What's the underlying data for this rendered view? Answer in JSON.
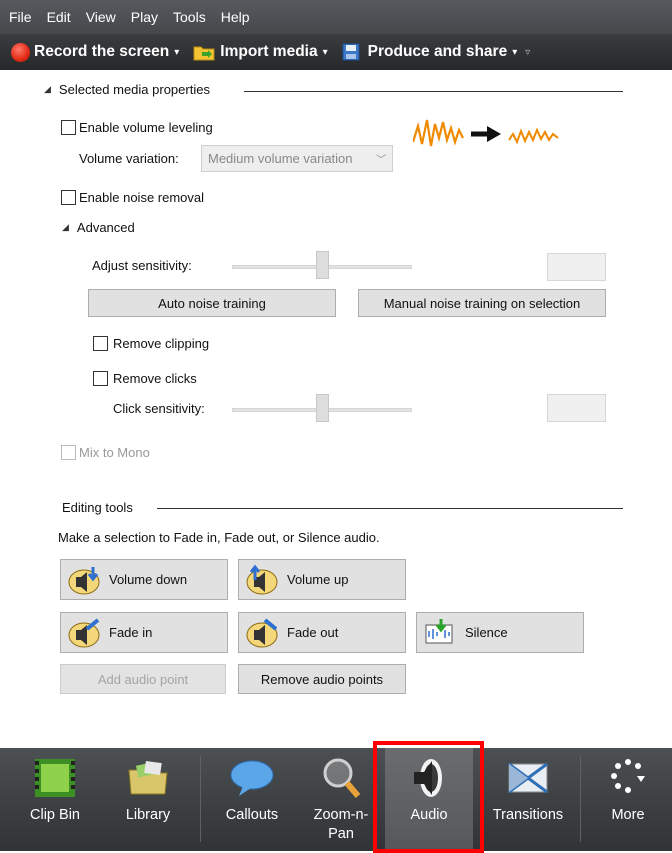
{
  "menu": [
    "File",
    "Edit",
    "View",
    "Play",
    "Tools",
    "Help"
  ],
  "toolbar": {
    "record": "Record the screen",
    "import": "Import media",
    "produce": "Produce and share",
    "arrow": "▾",
    "overflow": "▿"
  },
  "media_props": {
    "heading": "Selected media properties",
    "volume_leveling": "Enable volume leveling",
    "volume_variation_label": "Volume variation:",
    "volume_variation_value": "Medium volume variation",
    "noise_removal": "Enable noise removal",
    "advanced": "Advanced",
    "adjust_sensitivity": "Adjust sensitivity:",
    "auto_noise": "Auto noise training",
    "manual_noise": "Manual noise training on selection",
    "remove_clipping": "Remove clipping",
    "remove_clicks": "Remove clicks",
    "click_sensitivity": "Click sensitivity:",
    "mix_mono": "Mix to Mono",
    "adjust_sensitivity_level": 0.5,
    "click_sensitivity_level": 0.5
  },
  "editing": {
    "heading": "Editing tools",
    "hint": "Make a selection to Fade in, Fade out, or Silence audio.",
    "volume_down": "Volume down",
    "volume_up": "Volume up",
    "fade_in": "Fade in",
    "fade_out": "Fade out",
    "silence": "Silence",
    "add_point": "Add audio point",
    "remove_points": "Remove audio points"
  },
  "bottom": {
    "clip_bin": "Clip Bin",
    "library": "Library",
    "callouts": "Callouts",
    "zoom_line1": "Zoom-n-",
    "zoom_line2": "Pan",
    "audio": "Audio",
    "transitions": "Transitions",
    "more": "More"
  },
  "colors": {
    "highlight": "#ff0000",
    "accent_orange": "#f08a00",
    "record_red": "#e02a14"
  }
}
